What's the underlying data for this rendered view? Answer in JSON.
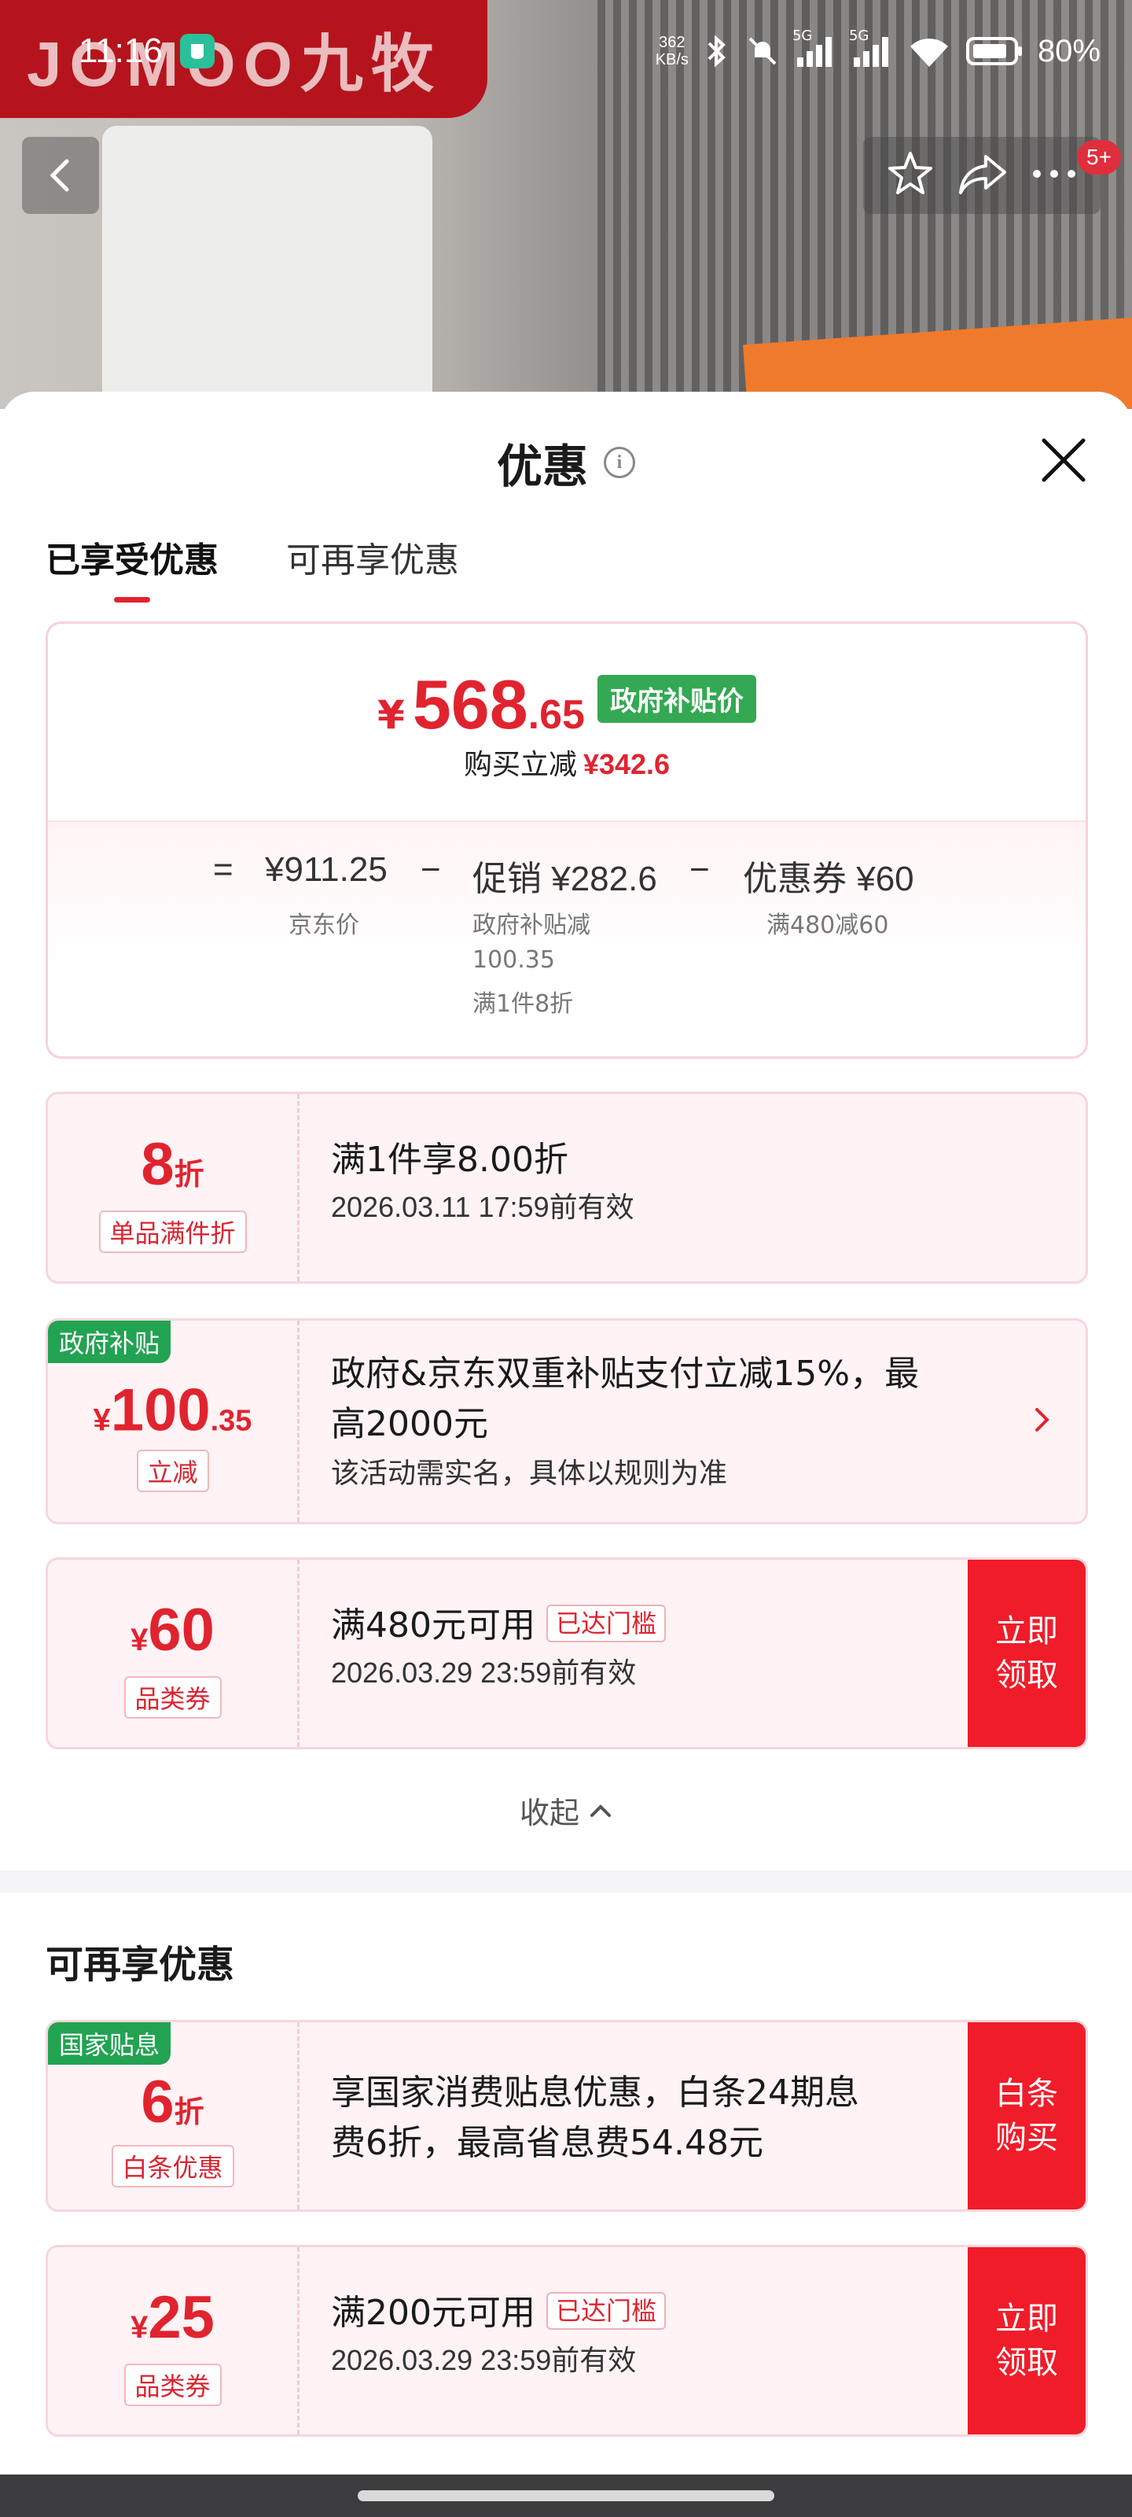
{
  "status_bar": {
    "time": "11:16",
    "speed_value": "362",
    "speed_unit": "KB/s",
    "network_1": "5G",
    "network_2": "5G",
    "battery": "80%"
  },
  "product_bg": {
    "brand_logo": "JOMOO九牧"
  },
  "notification_count": "5+",
  "sheet": {
    "title": "优惠",
    "tabs": [
      {
        "label": "已享受优惠",
        "active": true
      },
      {
        "label": "可再享优惠",
        "active": false
      }
    ]
  },
  "summary": {
    "currency": "¥",
    "final_price_int": "568",
    "final_price_dec": ".65",
    "price_tag": "政府补贴价",
    "instant_cut_label": "购买立减",
    "instant_cut_value": "¥342.6",
    "equals": "=",
    "jd_price": "¥911.25",
    "jd_price_label": "京东价",
    "minus_1": "−",
    "promo": "促销 ¥282.6",
    "promo_note_1": "政府补贴减",
    "promo_note_2": "100.35",
    "promo_note_3": "满1件8折",
    "minus_2": "−",
    "coupon": "优惠券 ¥60",
    "coupon_note": "满480减60"
  },
  "enjoyed_offers": [
    {
      "main_value": "8",
      "main_unit": "折",
      "chip": "单品满件折",
      "title": "满1件享8.00折",
      "subtitle": "2026.03.11 17:59前有效"
    },
    {
      "corner_tag": "政府补贴",
      "currency": "¥",
      "main_value": "100",
      "main_dec": ".35",
      "chip": "立减",
      "title_line_1": "政府&京东双重补贴支付立减15%，最",
      "title_line_2": "高2000元",
      "subtitle": "该活动需实名，具体以规则为准"
    },
    {
      "currency": "¥",
      "main_value": "60",
      "chip": "品类券",
      "title": "满480元可用",
      "threshold_tag": "已达门槛",
      "subtitle": "2026.03.29 23:59前有效",
      "action_line_1": "立即",
      "action_line_2": "领取"
    }
  ],
  "collapse_label": "收起",
  "more_section": {
    "title": "可再享优惠",
    "offers": [
      {
        "corner_tag": "国家贴息",
        "main_value": "6",
        "main_unit": "折",
        "chip": "白条优惠",
        "title_line_1": "享国家消费贴息优惠，白条24期息",
        "title_line_2": "费6折，最高省息费54.48元",
        "action_line_1": "白条",
        "action_line_2": "购买"
      },
      {
        "currency": "¥",
        "main_value": "25",
        "chip": "品类券",
        "title": "满200元可用",
        "threshold_tag": "已达门槛",
        "subtitle": "2026.03.29 23:59前有效",
        "action_line_1": "立即",
        "action_line_2": "领取"
      }
    ]
  },
  "colors": {
    "accent_red": "#e0242f",
    "action_red": "#f01c2a",
    "gov_green": "#34a853",
    "card_bg": "#fff3f5"
  },
  "icons": [
    "back-chevron-icon",
    "star-icon",
    "share-icon",
    "more-icon",
    "info-icon",
    "close-icon",
    "chevron-right-icon",
    "chevron-up-icon"
  ]
}
